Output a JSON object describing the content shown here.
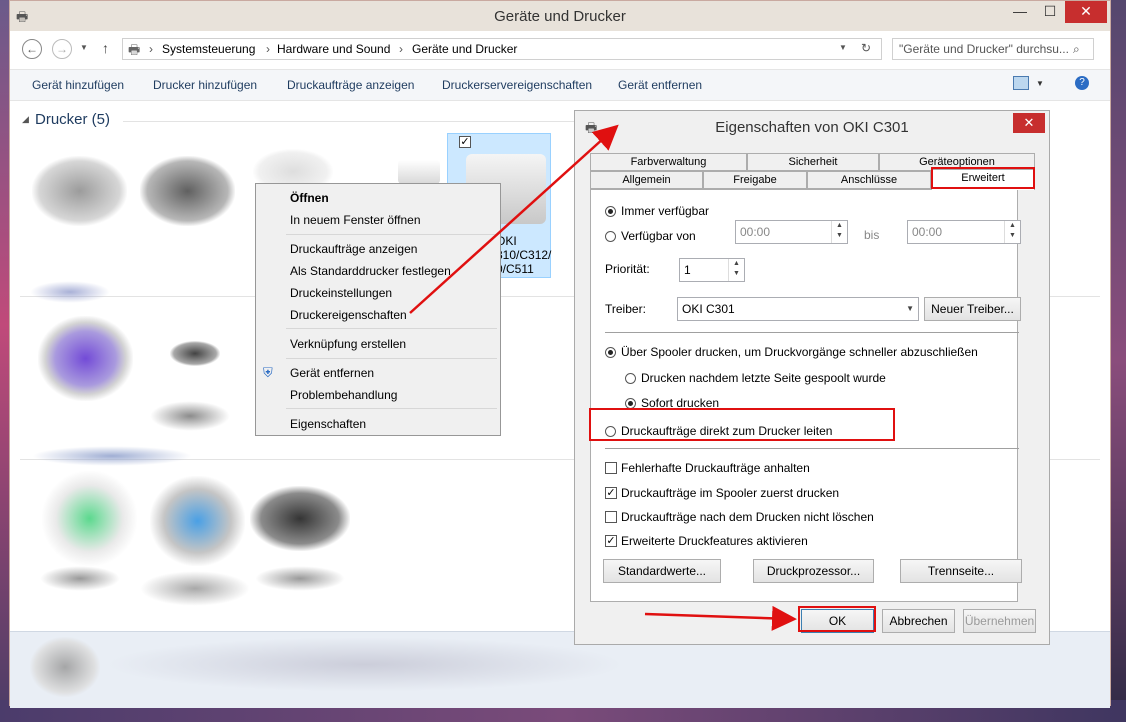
{
  "window": {
    "title": "Geräte und Drucker",
    "minimize": "—",
    "maximize": "☐",
    "close": "✕"
  },
  "address": {
    "back": "←",
    "forward": "→",
    "up": "↑",
    "path": [
      "Systemsteuerung",
      "Hardware und Sound",
      "Geräte und Drucker"
    ],
    "separator": "›",
    "search_placeholder": "\"Geräte und Drucker\" durchsu..."
  },
  "commands": [
    "Gerät hinzufügen",
    "Drucker hinzufügen",
    "Druckaufträge anzeigen",
    "Druckerservereigenschaften",
    "Gerät entfernen"
  ],
  "section": {
    "title": "Drucker (5)"
  },
  "selected_printer": {
    "label_lines": [
      "OKI",
      "310/C312/",
      "0/C511"
    ]
  },
  "context_menu": {
    "items": [
      "Öffnen",
      "In neuem Fenster öffnen",
      "Druckaufträge anzeigen",
      "Als Standarddrucker festlegen",
      "Druckeinstellungen",
      "Druckereigenschaften",
      "Verknüpfung erstellen",
      "Gerät entfernen",
      "Problembehandlung",
      "Eigenschaften"
    ]
  },
  "dialog": {
    "title": "Eigenschaften von OKI C301",
    "close": "✕",
    "tabs_top": [
      "Farbverwaltung",
      "Sicherheit",
      "Geräteoptionen"
    ],
    "tabs_bottom": [
      "Allgemein",
      "Freigabe",
      "Anschlüsse",
      "Erweitert"
    ],
    "always_available": "Immer verfügbar",
    "available_from": "Verfügbar von",
    "time_from": "00:00",
    "time_to_label": "bis",
    "time_to": "00:00",
    "priority_label": "Priorität:",
    "priority_value": "1",
    "driver_label": "Treiber:",
    "driver_value": "OKI C301",
    "new_driver_button": "Neuer Treiber...",
    "spool_option": "Über Spooler drucken, um Druckvorgänge schneller abzuschließen",
    "spool_after_last": "Drucken nachdem letzte Seite gespoolt wurde",
    "spool_immediately": "Sofort drucken",
    "direct_print": "Druckaufträge direkt zum Drucker leiten",
    "hold_mismatched": "Fehlerhafte Druckaufträge anhalten",
    "print_spooled_first": "Druckaufträge im Spooler zuerst drucken",
    "keep_printed": "Druckaufträge nach dem Drucken nicht löschen",
    "advanced_features": "Erweiterte Druckfeatures aktivieren",
    "defaults_button": "Standardwerte...",
    "processor_button": "Druckprozessor...",
    "separator_button": "Trennseite...",
    "ok_button": "OK",
    "cancel_button": "Abbrechen",
    "apply_button": "Übernehmen"
  },
  "colors": {
    "annotation_red": "#e01010",
    "selection_blue": "#cce8ff",
    "link_blue": "#1e3b5f"
  }
}
